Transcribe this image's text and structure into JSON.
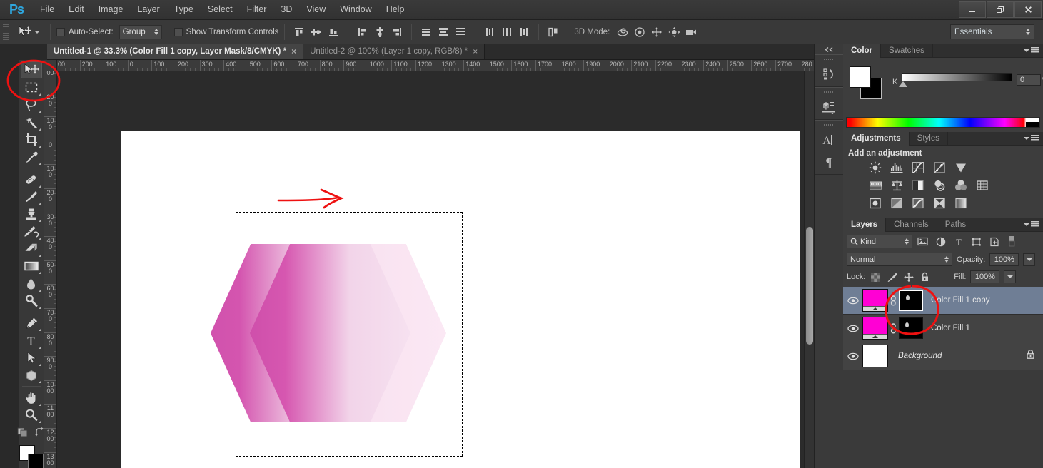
{
  "app": {
    "name": "Ps",
    "logo_color": "#2fa8e0"
  },
  "menubar": {
    "items": [
      "File",
      "Edit",
      "Image",
      "Layer",
      "Type",
      "Select",
      "Filter",
      "3D",
      "View",
      "Window",
      "Help"
    ]
  },
  "window_controls": {
    "minimize": "—",
    "restore": "❐",
    "close": "✕"
  },
  "options_bar": {
    "tool_icon": "move-tool-icon",
    "auto_select_label": "Auto-Select:",
    "auto_select_checked": false,
    "auto_select_value": "Group",
    "show_transform_label": "Show Transform Controls",
    "show_transform_checked": false,
    "align_icons": [
      "align-top-edges-icon",
      "align-vertical-centers-icon",
      "align-bottom-edges-icon",
      "align-left-edges-icon",
      "align-horizontal-centers-icon",
      "align-right-edges-icon"
    ],
    "distribute_icons": [
      "distribute-top-edges-icon",
      "distribute-vertical-centers-icon",
      "distribute-bottom-edges-icon",
      "distribute-left-edges-icon",
      "distribute-horizontal-centers-icon",
      "distribute-right-edges-icon"
    ],
    "extra_icons": [
      "auto-align-layers-icon"
    ],
    "mode3d_label": "3D Mode:",
    "mode3d_icons": [
      "3d-orbit-icon",
      "3d-roll-icon",
      "3d-pan-icon",
      "3d-slide-icon",
      "3d-camera-icon"
    ],
    "workspace": "Essentials"
  },
  "tabs": [
    {
      "title": "Untitled-1 @ 33.3% (Color Fill 1 copy, Layer Mask/8/CMYK) *",
      "active": true,
      "close": "×"
    },
    {
      "title": "Untitled-2 @ 100% (Layer 1 copy, RGB/8) *",
      "active": false,
      "close": "×"
    }
  ],
  "toolbar": {
    "tools": [
      {
        "name": "move-tool",
        "selected": true,
        "sub": false
      },
      {
        "name": "rectangular-marquee-tool",
        "selected": false,
        "sub": true
      },
      {
        "name": "lasso-tool",
        "selected": false,
        "sub": true
      },
      {
        "name": "magic-wand-tool",
        "selected": false,
        "sub": true
      },
      {
        "name": "crop-tool",
        "selected": false,
        "sub": true
      },
      {
        "name": "eyedropper-tool",
        "selected": false,
        "sub": true
      },
      {
        "name": "spot-healing-brush-tool",
        "selected": false,
        "sub": true
      },
      {
        "name": "brush-tool",
        "selected": false,
        "sub": true
      },
      {
        "name": "clone-stamp-tool",
        "selected": false,
        "sub": true
      },
      {
        "name": "history-brush-tool",
        "selected": false,
        "sub": true
      },
      {
        "name": "eraser-tool",
        "selected": false,
        "sub": true
      },
      {
        "name": "gradient-tool",
        "selected": false,
        "sub": true
      },
      {
        "name": "blur-tool",
        "selected": false,
        "sub": true
      },
      {
        "name": "dodge-tool",
        "selected": false,
        "sub": true
      },
      {
        "name": "pen-tool",
        "selected": false,
        "sub": true
      },
      {
        "name": "horizontal-type-tool",
        "selected": false,
        "sub": true
      },
      {
        "name": "path-selection-tool",
        "selected": false,
        "sub": true
      },
      {
        "name": "polygon-shape-tool",
        "selected": false,
        "sub": true
      },
      {
        "name": "hand-tool",
        "selected": false,
        "sub": true
      },
      {
        "name": "zoom-tool",
        "selected": false,
        "sub": true
      }
    ],
    "quick_mask_icon": "quick-mask-icon",
    "screen_mode_icon": "screen-mode-icon",
    "foreground_color": "#ffffff",
    "background_color": "#000000"
  },
  "rulers": {
    "units": "px",
    "horizontal_labels": [
      "00",
      "200",
      "100",
      "0",
      "100",
      "200",
      "300",
      "400",
      "500",
      "600",
      "700",
      "800",
      "900",
      "1000",
      "1100",
      "1200",
      "1300",
      "1400",
      "1500",
      "1600",
      "1700",
      "1800",
      "1900",
      "2000",
      "2100",
      "2200",
      "2300",
      "2400",
      "2500",
      "2600",
      "2700",
      "280"
    ],
    "vertical_labels": [
      "00",
      "200",
      "100",
      "0",
      "100",
      "200",
      "300",
      "400",
      "500",
      "600",
      "700",
      "800",
      "900",
      "1000",
      "1100",
      "1200",
      "1300"
    ]
  },
  "canvas": {
    "zoom": "33.3%",
    "document": "Untitled-1",
    "background_color": "#ffffff",
    "selection_marquee": true,
    "annotation_arrow_color": "#ee1111",
    "shapes": [
      {
        "name": "hexagon-back-light",
        "fill_from": "#fbe6f2",
        "fill_to": "#f7ddee"
      },
      {
        "name": "hexagon-mid-gradient",
        "fill_from": "#cf53ac",
        "fill_to": "#f6e0f0"
      },
      {
        "name": "hexagon-front-gradient",
        "fill_from": "#d052ae",
        "fill_to": "#f7e4f1"
      }
    ]
  },
  "rail": {
    "collapse_icon": "collapse-panels-icon",
    "icons": [
      "history-panel-icon",
      "mini-bridge-panel-icon",
      "character-panel-icon",
      "paragraph-panel-icon"
    ]
  },
  "color_panel": {
    "tabs": [
      {
        "label": "Color",
        "active": true
      },
      {
        "label": "Swatches",
        "active": false
      }
    ],
    "menu_icon": "panel-menu-icon",
    "channel_label": "K",
    "value": "0",
    "unit": "%",
    "foreground_color": "#ffffff",
    "background_color": "#000000"
  },
  "adjustments_panel": {
    "tabs": [
      {
        "label": "Adjustments",
        "active": true
      },
      {
        "label": "Styles",
        "active": false
      }
    ],
    "menu_icon": "panel-menu-icon",
    "heading": "Add an adjustment",
    "rows": [
      [
        "brightness-contrast-icon",
        "levels-icon",
        "curves-icon",
        "exposure-icon",
        "vibrance-icon"
      ],
      [
        "hue-saturation-icon",
        "color-balance-icon",
        "black-white-icon",
        "photo-filter-icon",
        "channel-mixer-icon",
        "color-lookup-icon"
      ],
      [
        "invert-icon",
        "posterize-icon",
        "threshold-icon",
        "gradient-map-icon",
        "selective-color-icon"
      ]
    ]
  },
  "layers_panel": {
    "tabs": [
      {
        "label": "Layers",
        "active": true
      },
      {
        "label": "Channels",
        "active": false
      },
      {
        "label": "Paths",
        "active": false
      }
    ],
    "menu_icon": "panel-menu-icon",
    "filter_kind": "Kind",
    "filter_icons": [
      "filter-pixel-icon",
      "filter-adjustment-icon",
      "filter-type-icon",
      "filter-shape-icon",
      "filter-smart-object-icon"
    ],
    "filter_toggle": "filter-enable-toggle",
    "blend_mode": "Normal",
    "opacity_label": "Opacity:",
    "opacity_value": "100%",
    "fill_label": "Fill:",
    "fill_value": "100%",
    "lock_label": "Lock:",
    "lock_icons": [
      "lock-transparent-pixels-icon",
      "lock-image-pixels-icon",
      "lock-position-icon",
      "lock-all-icon"
    ],
    "layers": [
      {
        "name": "Color Fill 1 copy",
        "selected": true,
        "visible": true,
        "locked": false,
        "italic": false,
        "thumb_color": "#ff00d4",
        "has_mask": true,
        "mask_selected": true,
        "linked": true
      },
      {
        "name": "Color Fill 1",
        "selected": false,
        "visible": true,
        "locked": false,
        "italic": false,
        "thumb_color": "#ff00d4",
        "has_mask": true,
        "mask_selected": false,
        "linked": true
      },
      {
        "name": "Background",
        "selected": false,
        "visible": true,
        "locked": true,
        "italic": true,
        "thumb_color": "#ffffff",
        "has_mask": false,
        "mask_selected": false,
        "linked": false
      }
    ]
  },
  "annotations": [
    {
      "name": "red-circle-move-tool",
      "color": "#ee1111"
    },
    {
      "name": "red-arrow-canvas",
      "color": "#ee1111"
    },
    {
      "name": "red-circle-layer-mask",
      "color": "#ee1111"
    }
  ]
}
